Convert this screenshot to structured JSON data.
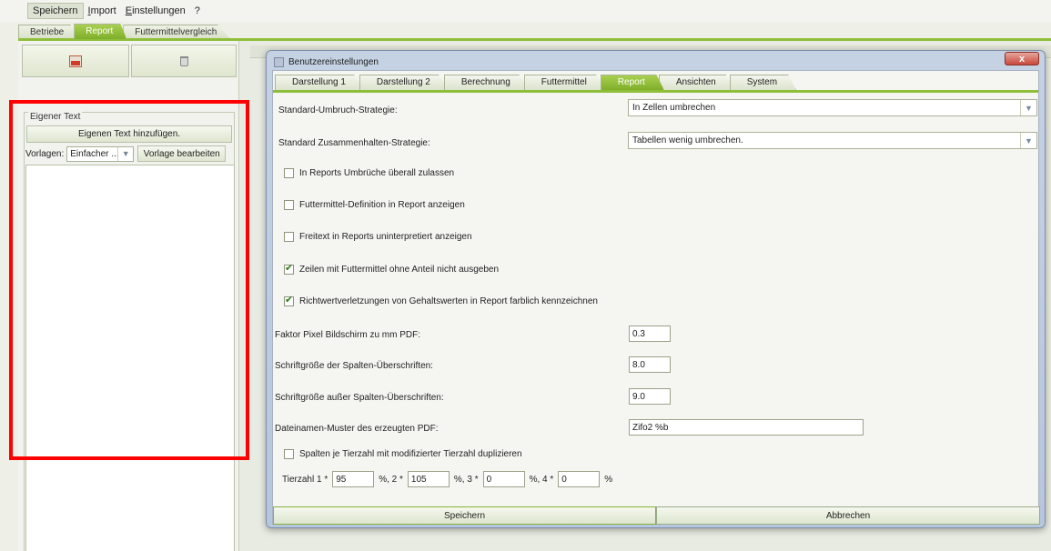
{
  "menu": {
    "save": "Speichern",
    "import_prefix": "I",
    "import_rest": "mport",
    "settings_prefix": "E",
    "settings_rest": "instellungen",
    "help": "?"
  },
  "main_tabs": [
    "Betriebe",
    "Report",
    "Futtermittelvergleich"
  ],
  "left_panel": {
    "group_title": "Eigener Text",
    "add_text_button": "Eigenen Text hinzufügen.",
    "templates_label": "Vorlagen:",
    "templates_value": "Einfacher ...",
    "edit_template_button": "Vorlage bearbeiten"
  },
  "dialog": {
    "title": "Benutzereinstellungen",
    "close": "x",
    "tabs": [
      "Darstellung 1",
      "Darstellung 2",
      "Berechnung",
      "Futtermittel",
      "Report",
      "Ansichten",
      "System"
    ],
    "break_strategy_label": "Standard-Umbruch-Strategie:",
    "break_strategy_value": "In Zellen umbrechen",
    "keep_strategy_label": "Standard Zusammenhalten-Strategie:",
    "keep_strategy_value": "Tabellen wenig umbrechen.",
    "checkboxes": [
      {
        "label": "In Reports Umbrüche überall zulassen",
        "checked": false
      },
      {
        "label": "Futtermittel-Definition in Report anzeigen",
        "checked": false
      },
      {
        "label": "Freitext in Reports uninterpretiert anzeigen",
        "checked": false
      },
      {
        "label": "Zeilen mit Futtermittel ohne Anteil nicht ausgeben",
        "checked": true
      },
      {
        "label": "Richtwertverletzungen von Gehaltswerten in Report farblich kennzeichnen",
        "checked": true
      }
    ],
    "pixel_factor_label": "Faktor Pixel Bildschirm zu mm PDF:",
    "pixel_factor_value": "0.3",
    "header_font_label": "Schriftgröße der Spalten-Überschriften:",
    "header_font_value": "8.0",
    "body_font_label": "Schriftgröße außer Spalten-Überschriften:",
    "body_font_value": "9.0",
    "filename_label": "Dateinamen-Muster des erzeugten PDF:",
    "filename_value": "Zifo2 %b",
    "duplicate_label": "Spalten je Tierzahl mit modifizierter Tierzahl duplizieren",
    "tierzahl_label": "Tierzahl 1 *",
    "tz1": "95",
    "sep2": "%, 2 *",
    "tz2": "105",
    "sep3": "%, 3 *",
    "tz3": "0",
    "sep4": "%, 4 *",
    "tz4": "0",
    "percent": "%",
    "save_button": "Speichern",
    "cancel_button": "Abbrechen"
  }
}
